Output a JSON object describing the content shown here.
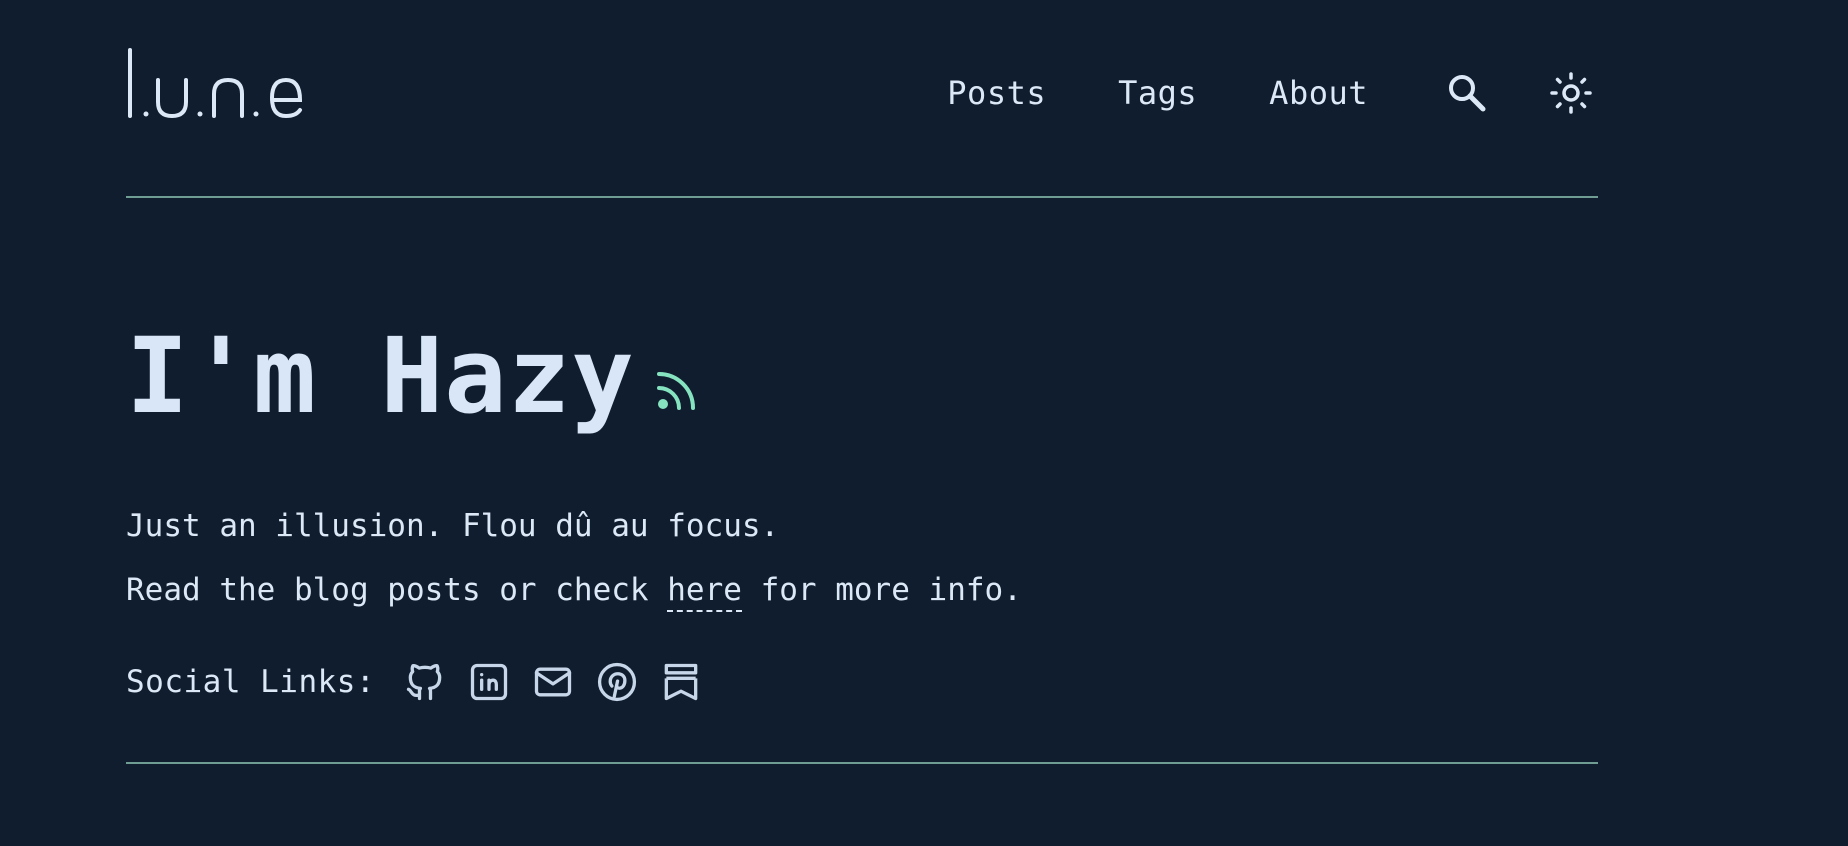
{
  "site": {
    "logo_text": "l.u.n.e",
    "logo_icon": "lune-logo"
  },
  "nav": {
    "items": [
      {
        "label": "Posts"
      },
      {
        "label": "Tags"
      },
      {
        "label": "About"
      }
    ],
    "search_icon": "search-icon",
    "theme_icon": "sun-icon"
  },
  "hero": {
    "title": "I'm Hazy",
    "rss_icon": "rss-icon",
    "line1": "Just an illusion. Flou dû au focus.",
    "line2_before": "Read the blog posts or check ",
    "line2_link": "here",
    "line2_after": " for more info."
  },
  "social": {
    "label": "Social Links:",
    "icons": [
      "github-icon",
      "linkedin-icon",
      "mail-icon",
      "pinterest-icon",
      "substack-icon"
    ]
  },
  "colors": {
    "background": "#0f1d2e",
    "text": "#dce8f6",
    "accent": "#86e3c0",
    "divider": "#6f9d94"
  }
}
